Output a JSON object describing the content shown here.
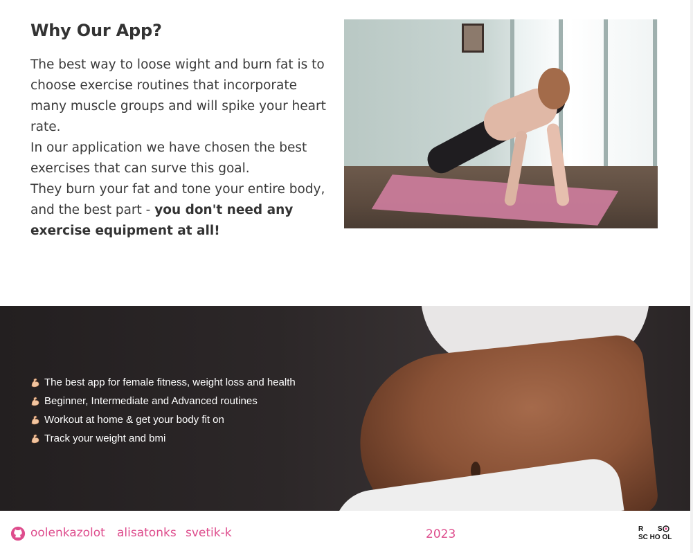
{
  "why": {
    "title": "Why Our App?",
    "p1": "The best way to loose wight and burn fat is to choose exercise routines that incorporate many muscle groups and will spike your heart rate.",
    "p2": "In our application we have chosen the best exercises that can surve this goal.",
    "p3_start": "They burn your fat and tone your entire body, and the best part - ",
    "p3_bold": "you don't need any exercise equipment at all!"
  },
  "features": [
    "The best app for female fitness, weight loss and health",
    "Beginner, Intermediate and Advanced routines",
    "Workout at home & get your body fit on",
    "Track your weight and bmi"
  ],
  "footer": {
    "authors": [
      "oolenkazolot",
      "alisatonks",
      "svetik-k"
    ],
    "year": "2023",
    "logo_text": "RS SCHOOL"
  },
  "colors": {
    "accent": "#de4d8d",
    "dark_bg": "#231f20",
    "text": "#333333"
  },
  "icons": {
    "feature_bullet": "flexed-biceps-icon",
    "github": "github-icon"
  }
}
